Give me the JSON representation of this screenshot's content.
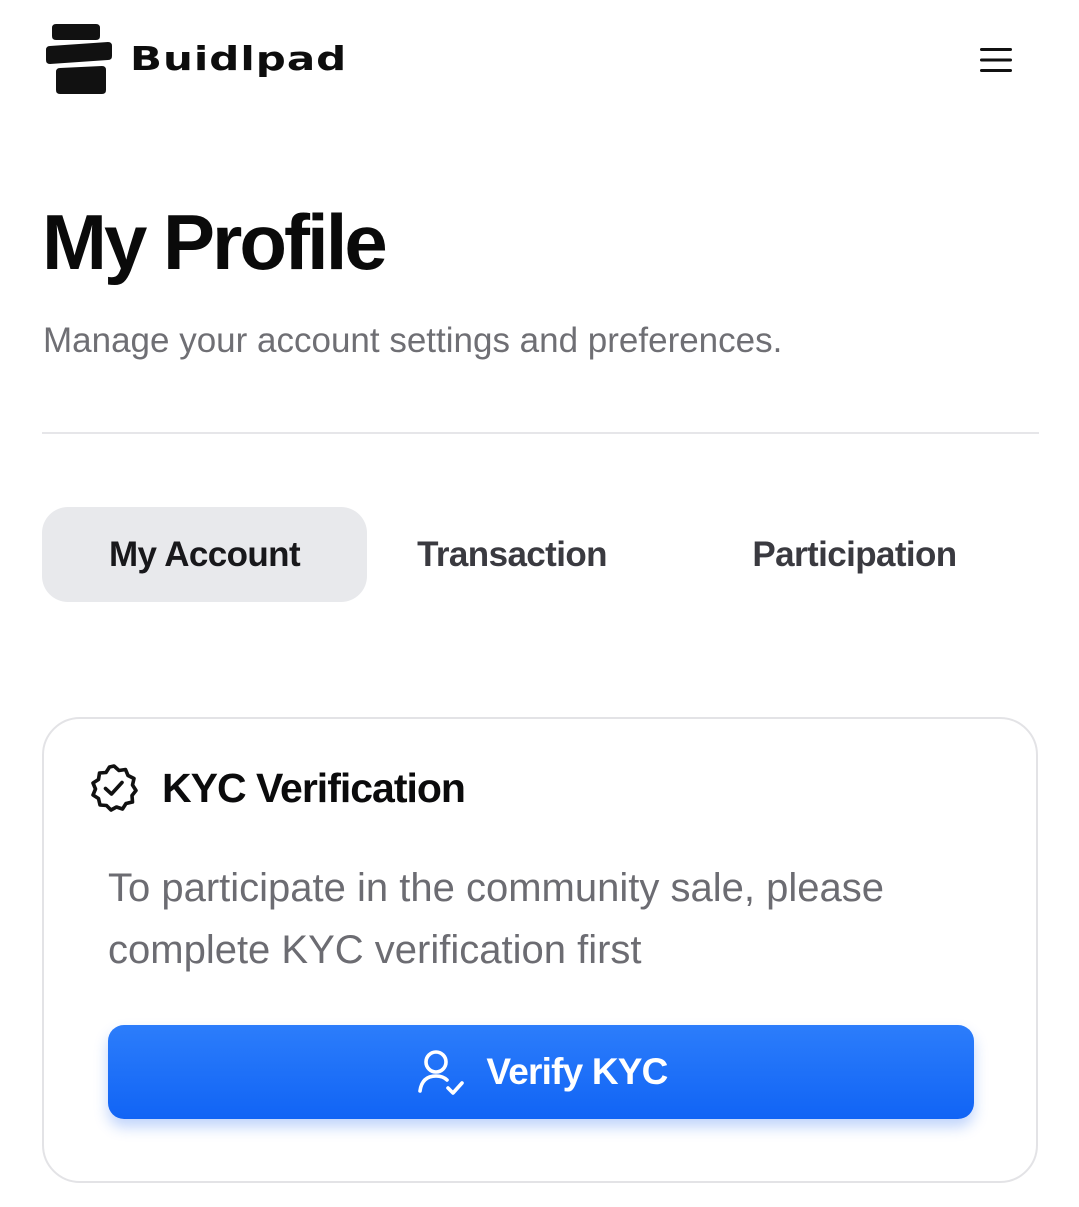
{
  "header": {
    "brand_name": "Buidlpad",
    "logo_icon": "buidlpad-logo-icon",
    "menu_icon": "hamburger-menu-icon"
  },
  "page": {
    "title": "My Profile",
    "subtitle": "Manage your account settings and preferences."
  },
  "tabs": [
    {
      "label": "My Account",
      "active": true
    },
    {
      "label": "Transaction",
      "active": false
    },
    {
      "label": "Participation",
      "active": false
    }
  ],
  "kyc_card": {
    "icon": "verified-badge-icon",
    "title": "KYC Verification",
    "description": "To participate in the community sale, please complete KYC verification first",
    "button_icon": "user-check-icon",
    "button_label": "Verify KYC"
  },
  "colors": {
    "primary_button": "#1a6ef8",
    "active_tab_bg": "#e8e9ec",
    "muted_text": "#6f6f74",
    "border": "#e3e3e6"
  }
}
